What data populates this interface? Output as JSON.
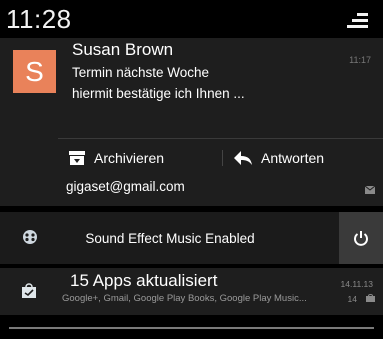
{
  "status_bar": {
    "time": "11:28",
    "quick_settings_icon": "quick-settings-icon"
  },
  "email_notification": {
    "avatar_letter": "S",
    "avatar_color": "#e9825a",
    "sender": "Susan Brown",
    "time": "11:17",
    "subject": "Termin nächste Woche",
    "snippet": "hiermit bestätige ich Ihnen ...",
    "actions": [
      {
        "label": "Archivieren",
        "icon": "archive-icon"
      },
      {
        "label": "Antworten",
        "icon": "reply-icon"
      }
    ],
    "account": "gigaset@gmail.com",
    "app_icon": "mail-icon"
  },
  "sound_notification": {
    "text": "Sound Effect Music Enabled",
    "icon": "sound-effect-icon",
    "button_icon": "power-icon"
  },
  "apps_notification": {
    "title": "15 Apps aktualisiert",
    "subtitle": "Google+, Gmail, Google Play Books, Google Play Music...",
    "time": "14.11.13",
    "count": "14",
    "icon": "store-icon"
  }
}
